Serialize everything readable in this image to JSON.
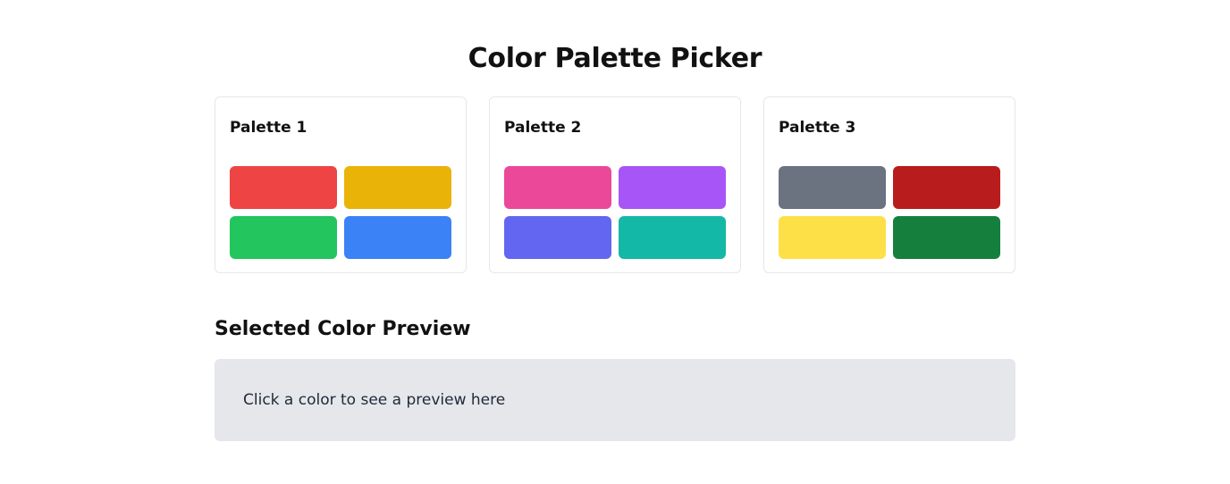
{
  "page": {
    "title": "Color Palette Picker"
  },
  "palettes": [
    {
      "name": "Palette 1",
      "colors": [
        "#ef4444",
        "#eab308",
        "#22c55e",
        "#3b82f6"
      ]
    },
    {
      "name": "Palette 2",
      "colors": [
        "#ec4899",
        "#a855f7",
        "#6366f1",
        "#14b8a6"
      ]
    },
    {
      "name": "Palette 3",
      "colors": [
        "#6b7280",
        "#b91c1c",
        "#fde047",
        "#15803d"
      ]
    }
  ],
  "preview": {
    "heading": "Selected Color Preview",
    "placeholder": "Click a color to see a preview here",
    "background": "#e5e7eb"
  }
}
